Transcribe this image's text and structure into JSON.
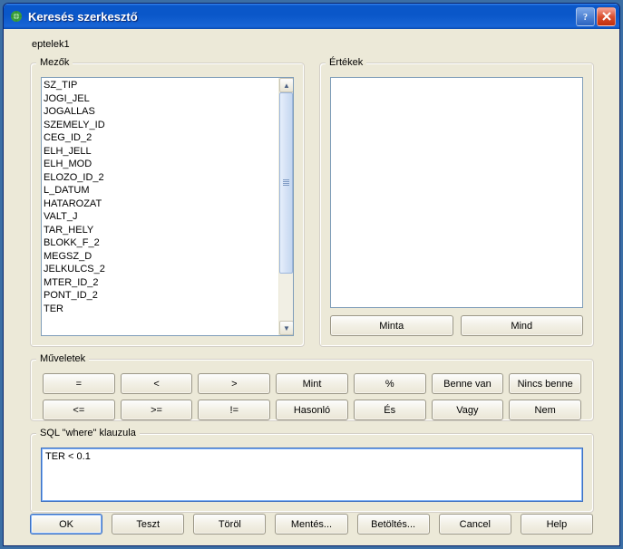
{
  "window": {
    "title": "Keresés szerkesztő"
  },
  "context": "eptelek1",
  "groups": {
    "fields": "Mezők",
    "values": "Értékek",
    "ops": "Műveletek",
    "sql": "SQL \"where\" klauzula"
  },
  "fields": [
    "SZ_TIP",
    "JOGI_JEL",
    "JOGALLAS",
    "SZEMELY_ID",
    "CEG_ID_2",
    "ELH_JELL",
    "ELH_MOD",
    "ELOZO_ID_2",
    "L_DATUM",
    "HATAROZAT",
    "VALT_J",
    "TAR_HELY",
    "BLOKK_F_2",
    "MEGSZ_D",
    "JELKULCS_2",
    "MTER_ID_2",
    "PONT_ID_2",
    "TER"
  ],
  "valueButtons": {
    "sample": "Minta",
    "all": "Mind"
  },
  "ops": {
    "eq": "=",
    "lt": "<",
    "gt": ">",
    "like": "Mint",
    "pct": "%",
    "in": "Benne van",
    "notin": "Nincs benne",
    "le": "<=",
    "ge": ">=",
    "ne": "!=",
    "similar": "Hasonló",
    "and": "És",
    "or": "Vagy",
    "not": "Nem"
  },
  "sql": "TER < 0.1",
  "buttons": {
    "ok": "OK",
    "test": "Teszt",
    "clear": "Töröl",
    "save": "Mentés...",
    "load": "Betöltés...",
    "cancel": "Cancel",
    "help": "Help"
  }
}
